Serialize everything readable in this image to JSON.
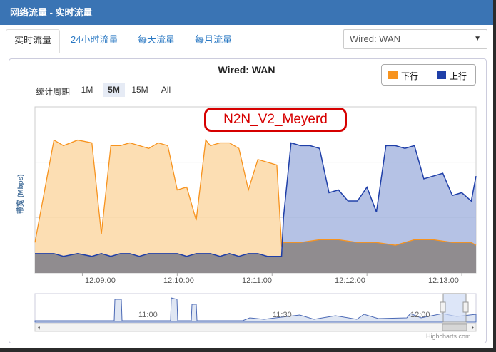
{
  "window": {
    "title": "网络流量 - 实时流量"
  },
  "tabs": [
    {
      "label": "实时流量",
      "active": true
    },
    {
      "label": "24小时流量"
    },
    {
      "label": "每天流量"
    },
    {
      "label": "每月流量"
    }
  ],
  "interface_select": {
    "value": "Wired: WAN"
  },
  "chart": {
    "title": "Wired: WAN",
    "zoom_label": "统计周期",
    "zoom_buttons": [
      "1M",
      "5M",
      "15M",
      "All"
    ],
    "zoom_selected": "5M",
    "annotation": "N2N_V2_Meyerd",
    "credits": "Highcharts.com"
  },
  "colors": {
    "download": "#f7931e",
    "upload": "#1f3fa8",
    "download_fill": "#fbd8a6",
    "upload_fill": "#a8b7e0",
    "overlap_fill": "#8c8686",
    "title_bar": "#3a74b4"
  },
  "chart_data": {
    "type": "area",
    "title": "Wired: WAN",
    "ylabel": "带宽 (Mbps)",
    "y_ticks": [
      "2",
      "4"
    ],
    "ylim": [
      0,
      6
    ],
    "x_ticks": [
      "12:09:00",
      "12:10:00",
      "12:11:00",
      "12:12:00",
      "12:13:00"
    ],
    "legend": [
      "下行",
      "上行"
    ],
    "series": [
      {
        "name": "下行",
        "x_minutes": [
          8.5,
          8.7,
          8.8,
          8.95,
          9.1,
          9.2,
          9.3,
          9.4,
          9.5,
          9.6,
          9.7,
          9.8,
          9.9,
          10.0,
          10.1,
          10.2,
          10.3,
          10.35,
          10.45,
          10.55,
          10.65,
          10.75,
          10.85,
          10.95,
          11.05,
          11.1,
          11.12,
          11.3,
          11.5,
          11.7,
          11.9,
          12.1,
          12.3,
          12.5,
          12.7,
          12.9,
          13.1,
          13.15
        ],
        "values": [
          1.1,
          4.8,
          4.6,
          4.8,
          4.7,
          1.4,
          4.6,
          4.6,
          4.7,
          4.6,
          4.5,
          4.7,
          4.6,
          3.0,
          3.1,
          1.9,
          4.8,
          4.6,
          4.7,
          4.7,
          4.5,
          3.0,
          4.1,
          4.0,
          3.9,
          1.0,
          1.1,
          1.1,
          1.2,
          1.2,
          1.1,
          1.1,
          1.0,
          1.2,
          1.2,
          1.1,
          1.1,
          1.0
        ]
      },
      {
        "name": "上行",
        "x_minutes": [
          8.5,
          8.7,
          8.8,
          8.95,
          9.1,
          9.2,
          9.3,
          9.4,
          9.5,
          9.6,
          9.7,
          9.8,
          9.9,
          10.0,
          10.1,
          10.2,
          10.3,
          10.35,
          10.45,
          10.55,
          10.65,
          10.75,
          10.85,
          10.95,
          11.05,
          11.1,
          11.12,
          11.2,
          11.3,
          11.4,
          11.5,
          11.6,
          11.7,
          11.8,
          11.9,
          12.0,
          12.1,
          12.2,
          12.3,
          12.4,
          12.5,
          12.6,
          12.7,
          12.8,
          12.9,
          13.0,
          13.1,
          13.15
        ],
        "values": [
          0.7,
          0.7,
          0.6,
          0.7,
          0.6,
          0.7,
          0.6,
          0.7,
          0.7,
          0.6,
          0.7,
          0.7,
          0.7,
          0.7,
          0.6,
          0.7,
          0.7,
          0.7,
          0.6,
          0.7,
          0.6,
          0.7,
          0.7,
          0.6,
          0.6,
          0.6,
          2.0,
          4.7,
          4.6,
          4.6,
          4.5,
          2.9,
          3.0,
          2.6,
          2.6,
          3.1,
          2.2,
          4.6,
          4.6,
          4.5,
          4.6,
          3.4,
          3.5,
          3.6,
          2.8,
          2.9,
          2.6,
          3.5
        ]
      }
    ],
    "navigator_labels": [
      "11:00",
      "11:30",
      "12:00"
    ]
  }
}
